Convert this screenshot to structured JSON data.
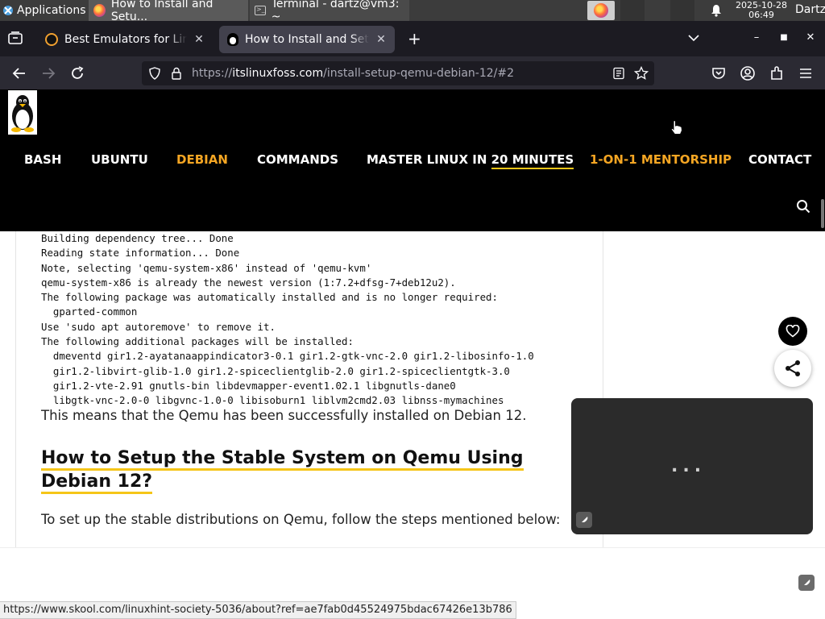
{
  "taskbar": {
    "applications_label": "Applications",
    "tasks": [
      {
        "label": "How to Install and Setu...",
        "icon": "firefox-icon"
      },
      {
        "label": "Terminal - dartz@vm3: ~",
        "icon": "terminal-icon"
      }
    ],
    "clock_date": "2025-10-28",
    "clock_time": "06:49",
    "user": "Dartz"
  },
  "browser": {
    "tabs": [
      {
        "title": "Best Emulators for Linux",
        "icon": "emulator-favicon",
        "active": false
      },
      {
        "title": "How to Install and Setup",
        "icon": "tux-favicon",
        "active": true
      }
    ],
    "url_prefix": "https://",
    "url_domain": "itslinuxfoss.com",
    "url_path": "/install-setup-qemu-debian-12/#2"
  },
  "site": {
    "menu": [
      {
        "label": "BASH",
        "highlight": false
      },
      {
        "label": "UBUNTU",
        "highlight": false
      },
      {
        "label": "DEBIAN",
        "highlight": true
      },
      {
        "label": "COMMANDS",
        "highlight": false
      },
      {
        "label_pre": "MASTER LINUX IN ",
        "label_ul": "20 MINUTES",
        "highlight": false
      },
      {
        "label": "1-ON-1 MENTORSHIP",
        "highlight": true
      },
      {
        "label": "CONTACT",
        "highlight": false
      }
    ]
  },
  "article": {
    "code_lines": [
      "Building dependency tree... Done",
      "Reading state information... Done",
      "Note, selecting 'qemu-system-x86' instead of 'qemu-kvm'",
      "qemu-system-x86 is already the newest version (1:7.2+dfsg-7+deb12u2).",
      "The following package was automatically installed and is no longer required:",
      "  gparted-common",
      "Use 'sudo apt autoremove' to remove it.",
      "The following additional packages will be installed:",
      "  dmeventd gir1.2-ayatanaappindicator3-0.1 gir1.2-gtk-vnc-2.0 gir1.2-libosinfo-1.0",
      "  gir1.2-libvirt-glib-1.0 gir1.2-spiceclientglib-2.0 gir1.2-spiceclientgtk-3.0",
      "  gir1.2-vte-2.91 gnutls-bin libdevmapper-event1.02.1 libgnutls-dane0",
      "  libgtk-vnc-2.0-0 libgvnc-1.0-0 libisoburn1 liblvm2cmd2.03 libnss-mymachines"
    ],
    "para1": "This means that the Qemu has been successfully installed on Debian 12.",
    "heading": "How to Setup the Stable System on Qemu Using Debian 12?",
    "para2": "To set up the stable distributions on Qemu, follow the steps mentioned below:"
  },
  "ad": {
    "loading": "..."
  },
  "status_url": "https://www.skool.com/linuxhint-society-5036/about?ref=ae7fab0d45524975bdac67426e13b786",
  "colors": {
    "accent_orange": "#f5a623",
    "underline_yellow": "#f5c518"
  }
}
